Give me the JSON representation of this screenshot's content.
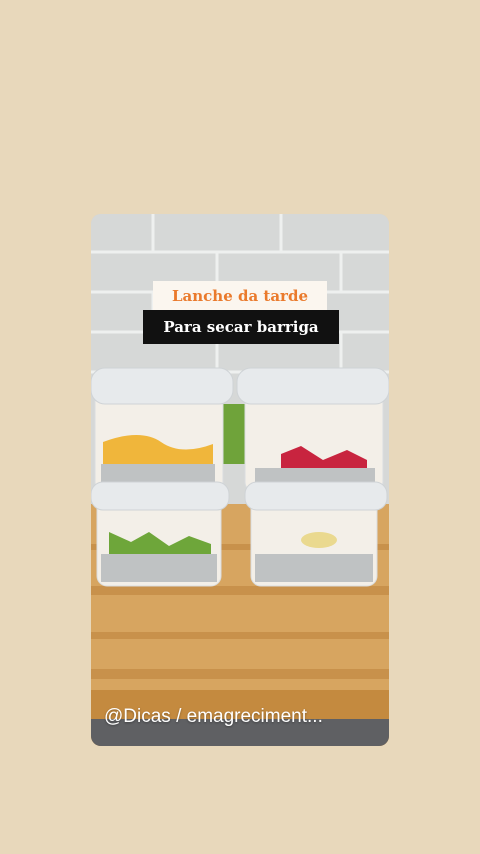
{
  "story": {
    "caption_top": "Lanche da tarde",
    "caption_bottom": "Para secar barriga",
    "author_handle": "@Dicas / emagreciment..."
  },
  "colors": {
    "page_background": "#e8d8bb",
    "caption_top_text": "#ea7a2c",
    "caption_top_bg": "#fbf6ef",
    "caption_bottom_bg": "#111111"
  }
}
